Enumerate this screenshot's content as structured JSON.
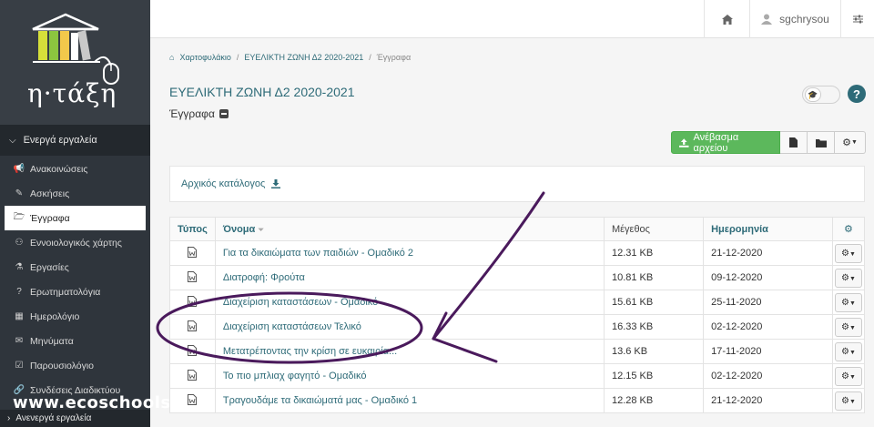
{
  "brand": {
    "logo_text": "η·τάξη"
  },
  "sidebar": {
    "active_header": "Ενεργά εργαλεία",
    "items": [
      {
        "label": "Ανακοινώσεις",
        "icon": "megaphone-icon",
        "glyph": "📢"
      },
      {
        "label": "Ασκήσεις",
        "icon": "edit-icon",
        "glyph": "✎"
      },
      {
        "label": "Έγγραφα",
        "icon": "folder-open-icon",
        "glyph": "🗁",
        "active": true
      },
      {
        "label": "Εννοιολογικός χάρτης",
        "icon": "sitemap-icon",
        "glyph": "⚇"
      },
      {
        "label": "Εργασίες",
        "icon": "flask-icon",
        "glyph": "⚗"
      },
      {
        "label": "Ερωτηματολόγια",
        "icon": "question-circle-icon",
        "glyph": "?"
      },
      {
        "label": "Ημερολόγιο",
        "icon": "calendar-icon",
        "glyph": "▦"
      },
      {
        "label": "Μηνύματα",
        "icon": "envelope-icon",
        "glyph": "✉"
      },
      {
        "label": "Παρουσιολόγιο",
        "icon": "check-square-icon",
        "glyph": "☑"
      },
      {
        "label": "Συνδέσεις Διαδικτύου",
        "icon": "link-icon",
        "glyph": "🔗"
      }
    ],
    "inactive_footer": "Ανενεργά εργαλεία",
    "watermark": "www.ecoschools"
  },
  "topbar": {
    "username": "sgchrysou"
  },
  "breadcrumb": [
    "Χαρτοφυλάκιο",
    "ΕΥΕΛΙΚΤΗ ΖΩΝΗ Δ2 2020-2021",
    "Έγγραφα"
  ],
  "page": {
    "title": "ΕΥΕΛΙΚΤΗ ΖΩΝΗ Δ2 2020-2021",
    "subtitle": "Έγγραφα"
  },
  "actions": {
    "upload_label": "Ανέβασμα αρχείου"
  },
  "root_dir": {
    "label": "Αρχικός κατάλογος"
  },
  "table": {
    "headers": {
      "type": "Τύπος",
      "name": "Όνομα",
      "size": "Μέγεθος",
      "date": "Ημερομηνία"
    },
    "rows": [
      {
        "name": "Για τα δικαιώματα των παιδιών - Ομαδικό 2",
        "size": "12.31 KB",
        "date": "21-12-2020"
      },
      {
        "name": "Διατροφή: Φρούτα",
        "size": "10.81 KB",
        "date": "09-12-2020"
      },
      {
        "name": "Διαχείριση καταστάσεων - Ομαδικό",
        "size": "15.61 KB",
        "date": "25-11-2020"
      },
      {
        "name": "Διαχείριση καταστάσεων Τελικό",
        "size": "16.33 KB",
        "date": "02-12-2020"
      },
      {
        "name": "Μετατρέποντας την κρίση σε ευκαιρία...",
        "size": "13.6 KB",
        "date": "17-11-2020"
      },
      {
        "name": "Το πιο μπλιαχ φαγητό - Ομαδικό",
        "size": "12.15 KB",
        "date": "02-12-2020"
      },
      {
        "name": "Τραγουδάμε τα δικαιώματά μας - Ομαδικό 1",
        "size": "12.28 KB",
        "date": "21-12-2020"
      }
    ]
  },
  "colors": {
    "accent": "#2e6b78",
    "upload_green": "#5cb85c",
    "sidebar_dark": "#2f353c",
    "annotation_purple": "#4a1a5c"
  }
}
